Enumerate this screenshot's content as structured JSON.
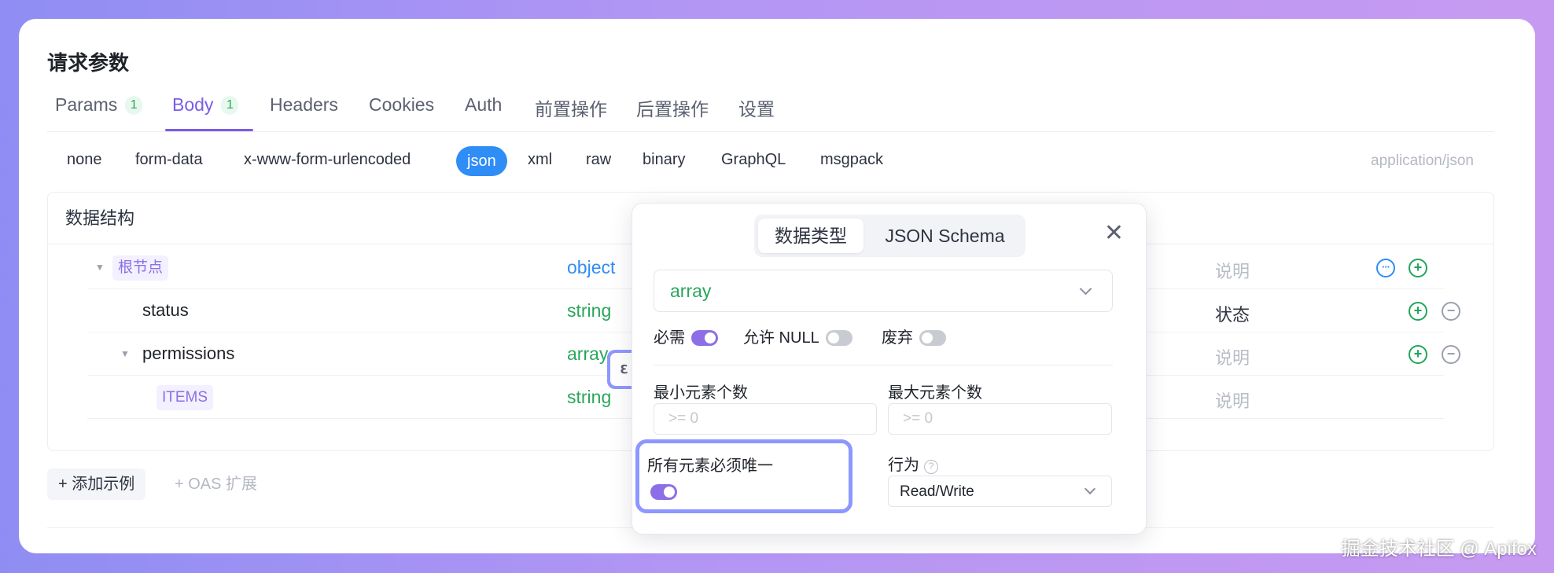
{
  "section_title": "请求参数",
  "tabs": [
    {
      "label": "Params",
      "count": "1"
    },
    {
      "label": "Body",
      "count": "1"
    },
    {
      "label": "Headers"
    },
    {
      "label": "Cookies"
    },
    {
      "label": "Auth"
    },
    {
      "label": "前置操作"
    },
    {
      "label": "后置操作"
    },
    {
      "label": "设置"
    }
  ],
  "active_tab": "Body",
  "body_types": [
    "none",
    "form-data",
    "x-www-form-urlencoded",
    "json",
    "xml",
    "raw",
    "binary",
    "GraphQL",
    "msgpack"
  ],
  "active_body_type": "json",
  "content_type": "application/json",
  "structure": {
    "title": "数据结构",
    "rows": [
      {
        "name": "根节点",
        "type": "object",
        "desc": "说明"
      },
      {
        "name": "status",
        "type": "string",
        "desc": "状态"
      },
      {
        "name": "permissions",
        "type": "array",
        "desc": "说明"
      },
      {
        "name": "ITEMS",
        "type": "string",
        "desc": "说明"
      }
    ],
    "row_actions": {
      "more": "···",
      "add": "+",
      "remove": "−"
    }
  },
  "footer": {
    "add_example": "+ 添加示例",
    "oas_extension": "+ OAS 扩展"
  },
  "popover": {
    "segments": [
      "数据类型",
      "JSON Schema"
    ],
    "active_segment": "数据类型",
    "close": "✕",
    "type_value": "array",
    "toggles": [
      {
        "label": "必需",
        "on": true
      },
      {
        "label": "允许 NULL",
        "on": false
      },
      {
        "label": "废弃",
        "on": false
      }
    ],
    "min_items_label": "最小元素个数",
    "min_items_placeholder": ">= 0",
    "max_items_label": "最大元素个数",
    "max_items_placeholder": ">= 0",
    "unique_label": "所有元素必须唯一",
    "unique_on": true,
    "behavior_label": "行为",
    "behavior_help": "?",
    "behavior_value": "Read/Write"
  },
  "schema_handle_icon": "ℇ",
  "colors": {
    "accent": "#7b5ce8",
    "green": "#2aa65a",
    "blue": "#2f8df6",
    "highlight": "#8d97ff"
  },
  "watermark": "掘金技术社区 @ Apifox"
}
